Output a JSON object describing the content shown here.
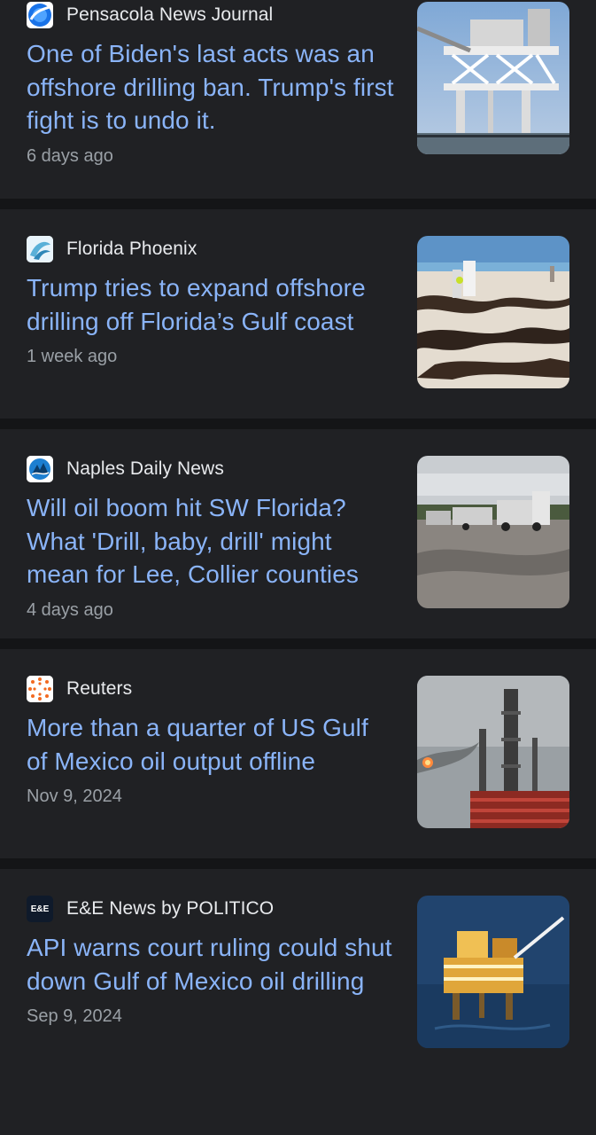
{
  "articles": [
    {
      "source": "Pensacola News Journal",
      "source_icon": "pensacola-globe-icon",
      "headline": "One of Biden's last acts was an offshore drilling ban. Trump's first fight is to undo it.",
      "age": "6 days ago",
      "image": "offshore-platform-photo"
    },
    {
      "source": "Florida Phoenix",
      "source_icon": "phoenix-logo-icon",
      "headline": "Trump tries to expand offshore drilling off Florida’s Gulf coast",
      "age": "1 week ago",
      "image": "oiled-beach-photo"
    },
    {
      "source": "Naples Daily News",
      "source_icon": "naples-logo-icon",
      "headline": "Will oil boom hit SW Florida? What 'Drill, baby, drill' might mean for Lee, Collier counties",
      "age": "4 days ago",
      "image": "oil-field-trucks-photo"
    },
    {
      "source": "Reuters",
      "source_icon": "reuters-logo-icon",
      "headline": "More than a quarter of US Gulf of Mexico oil output offline",
      "age": "Nov 9, 2024",
      "image": "refinery-flare-photo"
    },
    {
      "source": "E&E News by POLITICO",
      "source_icon": "ee-news-logo-icon",
      "source_icon_text": "E&E",
      "headline": "API warns court ruling could shut down Gulf of Mexico oil drilling",
      "age": "Sep 9, 2024",
      "image": "offshore-rig-at-sea-photo"
    }
  ],
  "colors": {
    "background": "#202124",
    "divider": "#141517",
    "headline": "#8ab4f8",
    "source_text": "#e8eaed",
    "age_text": "#9aa0a6"
  }
}
